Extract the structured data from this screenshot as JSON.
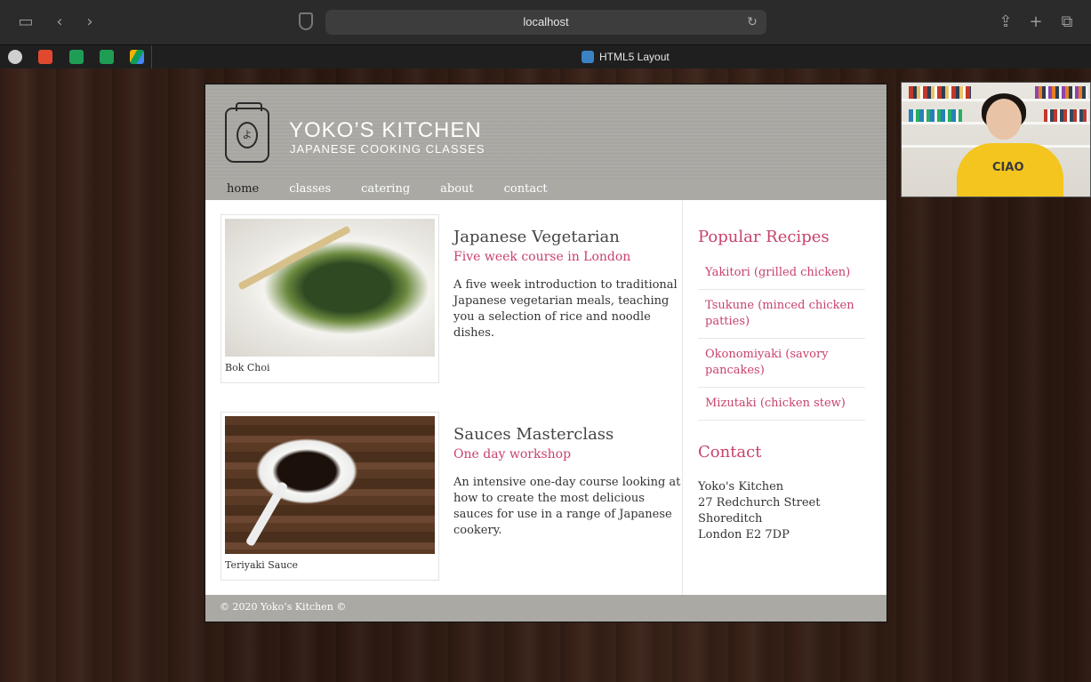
{
  "browser": {
    "url": "localhost",
    "tab_title": "HTML5 Layout"
  },
  "site": {
    "brand_title": "YOKO’S KITCHEN",
    "brand_subtitle": "JAPANESE COOKING CLASSES",
    "logo_glyph": "よ",
    "nav": [
      {
        "label": "home",
        "active": true
      },
      {
        "label": "classes",
        "active": false
      },
      {
        "label": "catering",
        "active": false
      },
      {
        "label": "about",
        "active": false
      },
      {
        "label": "contact",
        "active": false
      }
    ],
    "courses": [
      {
        "title": "Japanese Vegetarian",
        "subtitle": "Five week course in London",
        "description": "A five week introduction to traditional Japanese vegetarian meals, teaching you a selection of rice and noodle dishes.",
        "caption": "Bok Choi"
      },
      {
        "title": "Sauces Masterclass",
        "subtitle": "One day workshop",
        "description": "An intensive one-day course looking at how to create the most delicious sauces for use in a range of Japanese cookery.",
        "caption": "Teriyaki Sauce"
      }
    ],
    "sidebar": {
      "recipes_heading": "Popular Recipes",
      "recipes": [
        "Yakitori (grilled chicken)",
        "Tsukune (minced chicken patties)",
        "Okonomiyaki (savory pancakes)",
        "Mizutaki (chicken stew)"
      ],
      "contact_heading": "Contact",
      "address": [
        "Yoko's Kitchen",
        "27 Redchurch Street",
        "Shoreditch",
        "London E2 7DP"
      ]
    },
    "footer": "© 2020 Yoko’s Kitchen ©"
  },
  "webcam": {
    "shirt_text": "CIAO"
  },
  "colors": {
    "accent": "#c8426b",
    "header_gray": "#aaa9a4"
  }
}
